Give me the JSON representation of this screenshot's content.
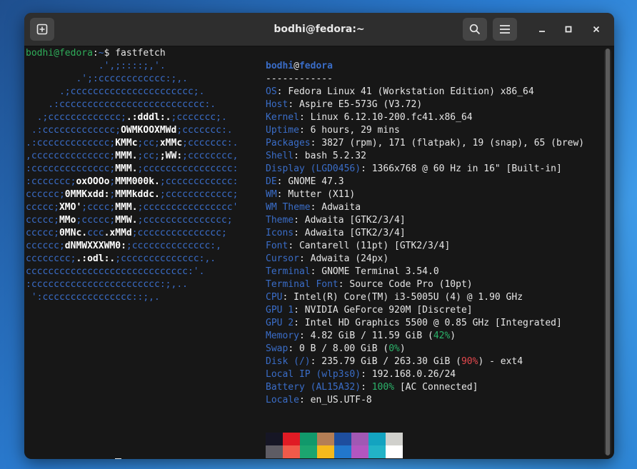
{
  "window": {
    "title": "bodhi@fedora:~"
  },
  "prompt": {
    "user_host": "bodhi@fedora",
    "sep": ":",
    "path": "~",
    "dollar": "$",
    "command": "fastfetch"
  },
  "logo_lines": [
    "             .',;::::;,'.",
    "         .';:cccccccccccc:;,.",
    "      .;cccccccccccccccccccccc;.",
    "    .:cccccccccccccccccccccccccc:.",
    "  .;ccccccccccccc;.:dddl:.;ccccccc;.",
    " .:ccccccccccccc;OWMKOOXMWd;ccccccc:.",
    ".:ccccccccccccc;KMMc;cc;xMMc;ccccccc:.",
    ",cccccccccccccc;MMM.;cc;;WW:;cccccccc,",
    ":cccccccccccccc;MMM.;cccccccccccccccc:",
    ":ccccccc;oxOOOo;MMM000k.;cccccccccccc:",
    "cccccc;0MMKxdd:;MMMkddc.;cccccccccccc;",
    "ccccc;XMO';cccc;MMM.;cccccccccccccccc'",
    "ccccc;MMo;ccccc;MMW.;ccccccccccccccc;",
    "ccccc;0MNc.ccc.xMMd;ccccccccccccccc;",
    "cccccc;dNMWXXXWM0:;cccccccccccccc:,",
    "cccccccc;.:odl:.;cccccccccccccc:,.",
    "ccccccccccccccccccccccccccccc:'.",
    ":ccccccccccccccccccccccc:;,..",
    " ':cccccccccccccccc::;,."
  ],
  "info": {
    "user": "bodhi",
    "at": "@",
    "host": "fedora",
    "rule": "------------",
    "rows": [
      {
        "key": "OS",
        "value": "Fedora Linux 41 (Workstation Edition) x86_64"
      },
      {
        "key": "Host",
        "value": "Aspire E5-573G (V3.72)"
      },
      {
        "key": "Kernel",
        "value": "Linux 6.12.10-200.fc41.x86_64"
      },
      {
        "key": "Uptime",
        "value": "6 hours, 29 mins"
      },
      {
        "key": "Packages",
        "value": "3827 (rpm), 171 (flatpak), 19 (snap), 65 (brew)"
      },
      {
        "key": "Shell",
        "value": "bash 5.2.32"
      },
      {
        "key": "Display (LGD0456)",
        "value": "1366x768 @ 60 Hz in 16\" [Built-in]"
      },
      {
        "key": "DE",
        "value": "GNOME 47.3"
      },
      {
        "key": "WM",
        "value": "Mutter (X11)"
      },
      {
        "key": "WM Theme",
        "value": "Adwaita"
      },
      {
        "key": "Theme",
        "value": "Adwaita [GTK2/3/4]"
      },
      {
        "key": "Icons",
        "value": "Adwaita [GTK2/3/4]"
      },
      {
        "key": "Font",
        "value": "Cantarell (11pt) [GTK2/3/4]"
      },
      {
        "key": "Cursor",
        "value": "Adwaita (24px)"
      },
      {
        "key": "Terminal",
        "value": "GNOME Terminal 3.54.0"
      },
      {
        "key": "Terminal Font",
        "value": "Source Code Pro (10pt)"
      },
      {
        "key": "CPU",
        "value": "Intel(R) Core(TM) i3-5005U (4) @ 1.90 GHz"
      },
      {
        "key": "GPU 1",
        "value": "NVIDIA GeForce 920M [Discrete]"
      },
      {
        "key": "GPU 2",
        "value": "Intel HD Graphics 5500 @ 0.85 GHz [Integrated]"
      }
    ],
    "memory": {
      "key": "Memory",
      "value": "4.82 GiB / 11.59 GiB (",
      "pct": "42%",
      "tail": ")"
    },
    "swap": {
      "key": "Swap",
      "value": "0 B / 8.00 GiB (",
      "pct": "0%",
      "tail": ")"
    },
    "disk": {
      "key": "Disk (/)",
      "value": "235.79 GiB / 263.30 GiB (",
      "pct": "90%",
      "tail": ") - ext4"
    },
    "localip": {
      "key": "Local IP (wlp3s0)",
      "value": "192.168.0.26/24"
    },
    "battery": {
      "key": "Battery (AL15A32)",
      "pct": "100%",
      "tail": " [AC Connected]"
    },
    "locale": {
      "key": "Locale",
      "value": "en_US.UTF-8"
    }
  },
  "palette_top": [
    "#161625",
    "#e01b24",
    "#11996b",
    "#b47e55",
    "#1e4e9e",
    "#a158b4",
    "#13a3c0",
    "#d0d0cc"
  ],
  "palette_bottom": [
    "#5e5c64",
    "#f15a4a",
    "#1ca56f",
    "#f6b91c",
    "#2277cc",
    "#b356c0",
    "#22b3c7",
    "#ffffff"
  ],
  "accent": {
    "key_blue": "#3a6dc8",
    "prompt_green": "#2fae5a",
    "ok_green": "#2bb36a",
    "warn_red": "#e5484d"
  }
}
